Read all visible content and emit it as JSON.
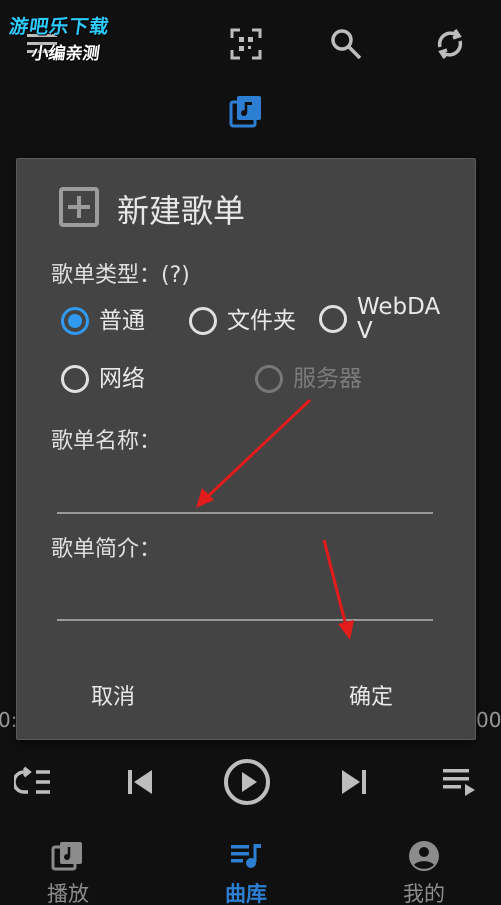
{
  "watermark": {
    "line1": "游吧乐下载",
    "line2": "小编亲测"
  },
  "side_time": {
    "left": "0:",
    "right": "00"
  },
  "dialog": {
    "title": "新建歌单",
    "type_label": "歌单类型：(?)",
    "options": [
      {
        "label": "普通",
        "checked": true
      },
      {
        "label": "文件夹",
        "checked": false
      },
      {
        "label": "WebDAV",
        "line1": "WebDA",
        "line2": "V",
        "checked": false
      },
      {
        "label": "网络",
        "checked": false
      },
      {
        "label": "服务器",
        "checked": false,
        "disabled": true
      }
    ],
    "name_label": "歌单名称：",
    "name_value": "",
    "intro_label": "歌单简介：",
    "intro_value": "",
    "cancel": "取消",
    "confirm": "确定"
  },
  "bottom_nav": [
    {
      "label": "播放",
      "icon": "music-note-icon",
      "active": false
    },
    {
      "label": "曲库",
      "icon": "playlist-icon",
      "active": true
    },
    {
      "label": "我的",
      "icon": "account-icon",
      "active": false
    }
  ],
  "colors": {
    "accent": "#2f9af0",
    "nav_active": "#2d7fd3",
    "dialog_bg": "#444444",
    "background": "#101010",
    "annotation_arrow": "#e21b1b"
  }
}
